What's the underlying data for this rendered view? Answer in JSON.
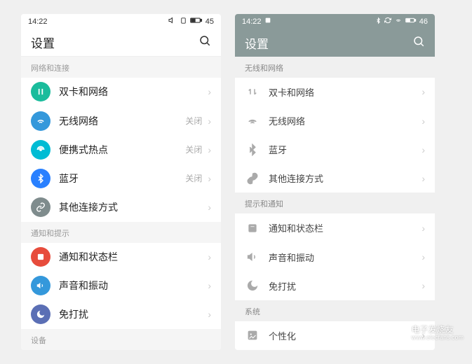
{
  "leftPhone": {
    "statusBar": {
      "time": "14:22",
      "battery": "45"
    },
    "header": {
      "title": "设置"
    },
    "sections": [
      {
        "header": "网络和连接",
        "items": [
          {
            "icon": "dual-sim-icon",
            "label": "双卡和网络",
            "status": ""
          },
          {
            "icon": "wifi-icon",
            "label": "无线网络",
            "status": "关闭"
          },
          {
            "icon": "hotspot-icon",
            "label": "便携式热点",
            "status": "关闭"
          },
          {
            "icon": "bluetooth-icon",
            "label": "蓝牙",
            "status": "关闭"
          },
          {
            "icon": "link-icon",
            "label": "其他连接方式",
            "status": ""
          }
        ]
      },
      {
        "header": "通知和提示",
        "items": [
          {
            "icon": "notification-icon",
            "label": "通知和状态栏",
            "status": ""
          },
          {
            "icon": "sound-icon",
            "label": "声音和振动",
            "status": ""
          },
          {
            "icon": "dnd-icon",
            "label": "免打扰",
            "status": ""
          }
        ]
      },
      {
        "header": "设备",
        "items": []
      }
    ]
  },
  "rightPhone": {
    "statusBar": {
      "time": "14:22",
      "battery": "46"
    },
    "header": {
      "title": "设置"
    },
    "sections": [
      {
        "header": "无线和网络",
        "items": [
          {
            "icon": "dual-sim-icon",
            "label": "双卡和网络"
          },
          {
            "icon": "wifi-icon",
            "label": "无线网络"
          },
          {
            "icon": "bluetooth-icon",
            "label": "蓝牙"
          },
          {
            "icon": "link-icon",
            "label": "其他连接方式"
          }
        ]
      },
      {
        "header": "提示和通知",
        "items": [
          {
            "icon": "notification-icon",
            "label": "通知和状态栏"
          },
          {
            "icon": "sound-icon",
            "label": "声音和振动"
          },
          {
            "icon": "dnd-icon",
            "label": "免打扰"
          }
        ]
      },
      {
        "header": "系统",
        "items": [
          {
            "icon": "personalize-icon",
            "label": "个性化"
          }
        ]
      }
    ]
  },
  "watermark": {
    "brand": "电子发烧友",
    "url": "www.elecfans.com"
  }
}
